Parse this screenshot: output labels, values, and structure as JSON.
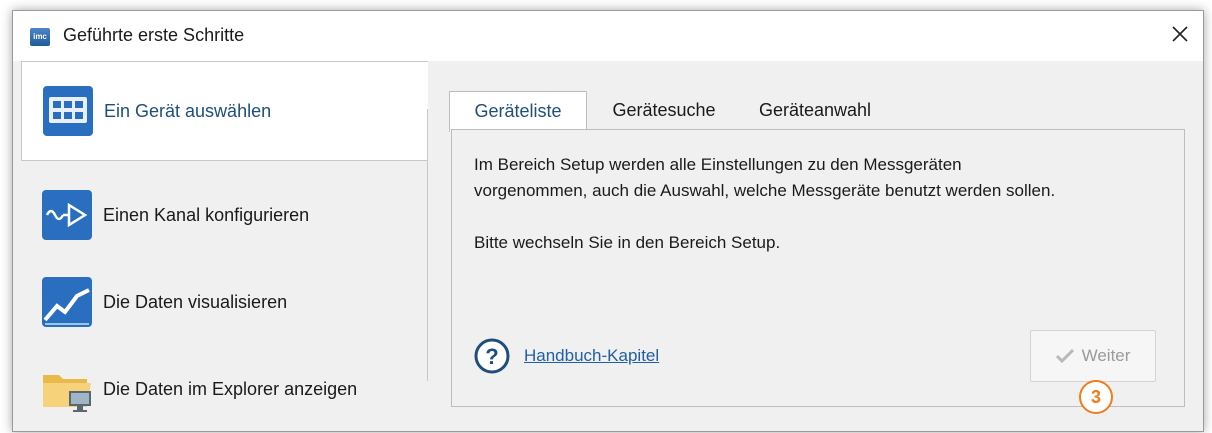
{
  "window": {
    "title": "Geführte erste Schritte",
    "app_icon_text": "imc",
    "close_icon": "close-icon"
  },
  "nav": {
    "items": [
      {
        "label": "Ein Gerät auswählen",
        "icon": "device-select-icon",
        "active": true
      },
      {
        "label": "Einen Kanal konfigurieren",
        "icon": "channel-configure-icon",
        "active": false
      },
      {
        "label": "Die Daten visualisieren",
        "icon": "chart-visualize-icon",
        "active": false
      },
      {
        "label": "Die Daten im Explorer anzeigen",
        "icon": "folder-explorer-icon",
        "active": false
      }
    ]
  },
  "tabs": [
    {
      "label": "Geräteliste",
      "active": true
    },
    {
      "label": "Gerätesuche",
      "active": false
    },
    {
      "label": "Geräteanwahl",
      "active": false
    }
  ],
  "content": {
    "paragraph1": "Im Bereich Setup werden alle Einstellungen zu den Messgeräten vorgenommen, auch die Auswahl, welche Messgeräte benutzt werden sollen.",
    "paragraph2": "Bitte wechseln Sie in den Bereich Setup."
  },
  "help": {
    "icon": "help-icon",
    "link_label": "Handbuch-Kapitel"
  },
  "next_button": {
    "label": "Weiter",
    "icon": "checkmark-icon",
    "enabled": false
  },
  "annotation": {
    "badge_number": "3",
    "color": "#ef7d1a"
  },
  "colors": {
    "accent": "#1f4e79",
    "link": "#1f5fa8",
    "icon_blue": "#2a6fbf"
  }
}
